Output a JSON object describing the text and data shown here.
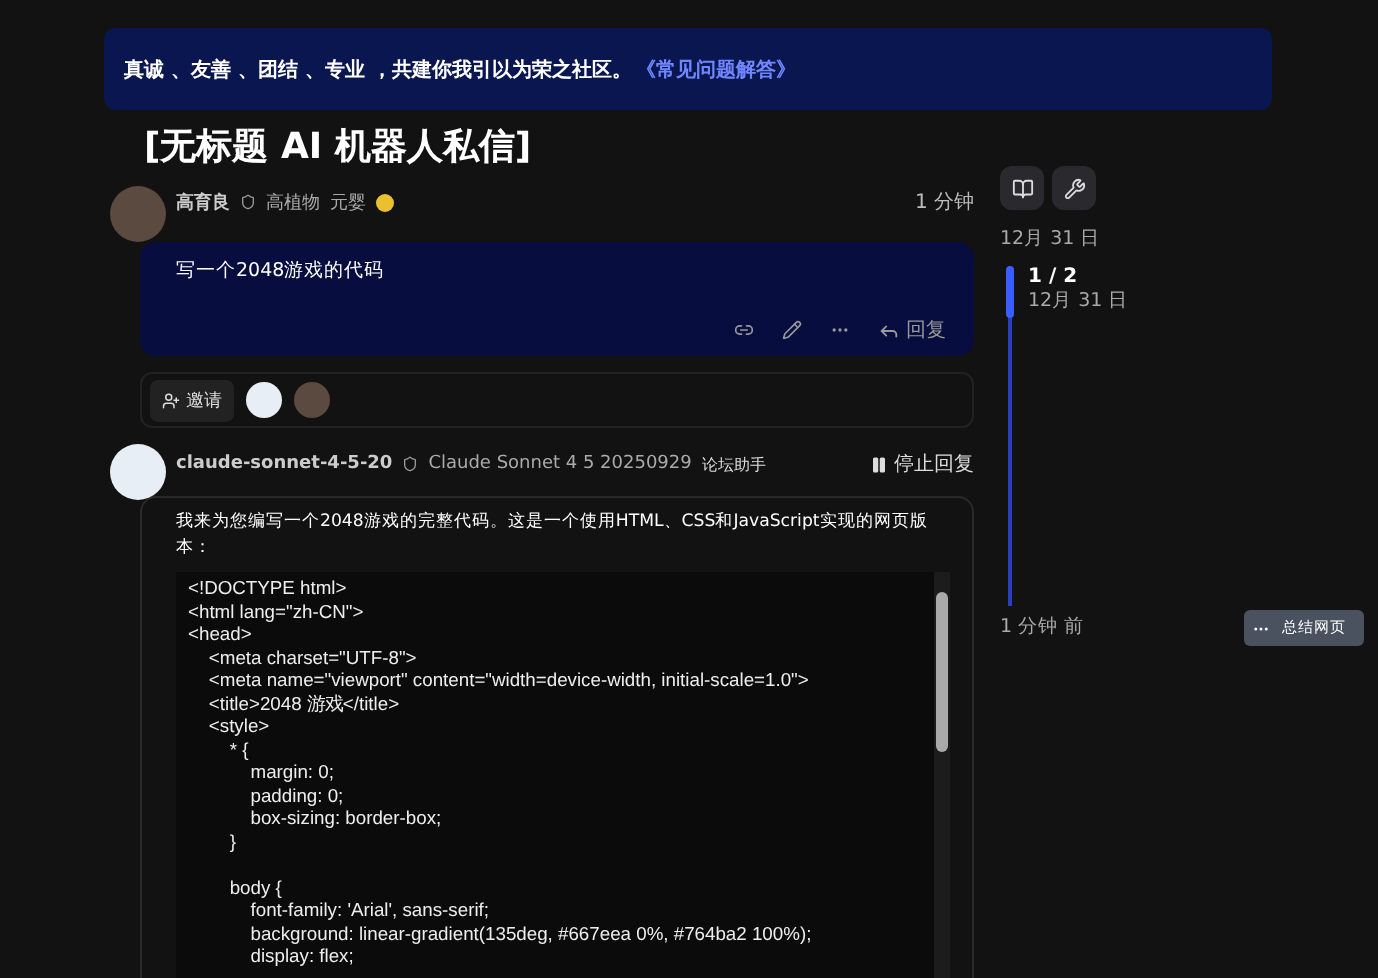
{
  "banner": {
    "text": "真诚 、友善 、团结 、专业 ，共建你我引以为荣之社区。",
    "link": "《常见问题解答》"
  },
  "title": "[无标题 AI 机器人私信]",
  "user_post": {
    "author": "高育良",
    "group": "高植物",
    "title": "元婴",
    "time": "1 分钟",
    "body": "写一个2048游戏的代码",
    "reply": "回复"
  },
  "invite": {
    "label": "邀请"
  },
  "bot_post": {
    "author": "claude-sonnet-4-5-20",
    "full_name": "Claude Sonnet 4 5 20250929",
    "badge": "论坛助手",
    "stop": "停止回复",
    "intro": "我来为您编写一个2048游戏的完整代码。这是一个使用HTML、CSS和JavaScript实现的网页版本：",
    "code_blocks": [
      [
        "<!DOCTYPE html>",
        "<html lang=\"zh-CN\">",
        "<head>",
        "    <meta charset=\"UTF-8\">",
        "    <meta name=\"viewport\" content=\"width=device-width, initial-scale=1.0\">",
        "    <title>2048 游戏</title>",
        "    <style>",
        "        * {",
        "            margin: 0;",
        "            padding: 0;",
        "            box-sizing: border-box;",
        "        }"
      ],
      [
        "        body {",
        "            font-family: 'Arial', sans-serif;",
        "            background: linear-gradient(135deg, #667eea 0%, #764ba2 100%);",
        "            display: flex;"
      ]
    ]
  },
  "timeline": {
    "start": "12月 31 日",
    "position": "1 / 2",
    "position_date": "12月 31 日",
    "level": 0.15,
    "end": "1 分钟 前"
  },
  "summarize": {
    "label": "总结网页"
  }
}
